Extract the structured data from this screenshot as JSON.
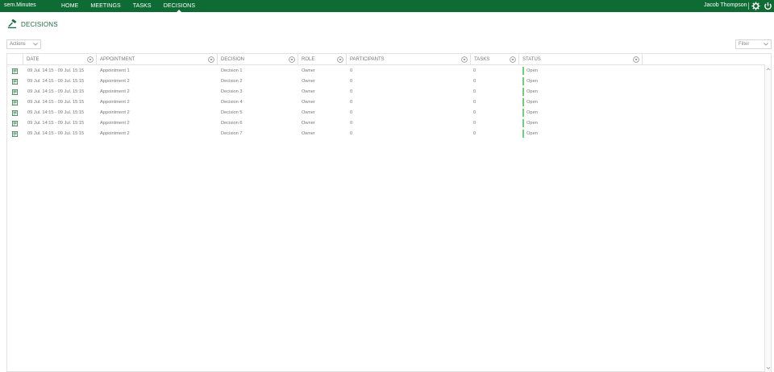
{
  "app": {
    "brand": "sem.Minutes",
    "user": "Jacob Thompson",
    "accent": "#0e6b34"
  },
  "nav": [
    {
      "label": "HOME"
    },
    {
      "label": "MEETINGS"
    },
    {
      "label": "TASKS"
    },
    {
      "label": "DECISIONS",
      "active": true
    }
  ],
  "page": {
    "title": "DECISIONS"
  },
  "toolbar": {
    "actions_label": "Actions",
    "filter_placeholder": "Filter"
  },
  "table": {
    "columns": [
      "DATE",
      "APPOINTMENT",
      "DECISION",
      "ROLE",
      "PARTICIPANTS",
      "TASKS",
      "STATUS"
    ],
    "rows": [
      {
        "date": "09 Jul. 14:15 - 09 Jul. 15:15",
        "appointment": "Appointment 1",
        "decision": "Decision 1",
        "role": "Owner",
        "participants": "0",
        "tasks": "0",
        "status": "Open"
      },
      {
        "date": "09 Jul. 14:15 - 09 Jul. 15:15",
        "appointment": "Appointment 2",
        "decision": "Decision 2",
        "role": "Owner",
        "participants": "0",
        "tasks": "0",
        "status": "Open"
      },
      {
        "date": "09 Jul. 14:15 - 09 Jul. 15:15",
        "appointment": "Appointment 2",
        "decision": "Decision 3",
        "role": "Owner",
        "participants": "0",
        "tasks": "0",
        "status": "Open"
      },
      {
        "date": "09 Jul. 14:15 - 09 Jul. 15:15",
        "appointment": "Appointment 2",
        "decision": "Decision 4",
        "role": "Owner",
        "participants": "0",
        "tasks": "0",
        "status": "Open"
      },
      {
        "date": "09 Jul. 14:15 - 09 Jul. 15:15",
        "appointment": "Appointment 2",
        "decision": "Decision 5",
        "role": "Owner",
        "participants": "0",
        "tasks": "0",
        "status": "Open"
      },
      {
        "date": "09 Jul. 14:15 - 09 Jul. 15:15",
        "appointment": "Appointment 2",
        "decision": "Decision 6",
        "role": "Owner",
        "participants": "0",
        "tasks": "0",
        "status": "Open"
      },
      {
        "date": "09 Jul. 14:15 - 09 Jul. 15:15",
        "appointment": "Appointment 2",
        "decision": "Decision 7",
        "role": "Owner",
        "participants": "0",
        "tasks": "0",
        "status": "Open"
      }
    ],
    "status_color": "#6ccf7a"
  },
  "icons": {
    "settings": "gear-icon",
    "logout": "power-icon",
    "page": "gavel-icon",
    "row": "document-icon",
    "column_filter": "filter-icon"
  }
}
